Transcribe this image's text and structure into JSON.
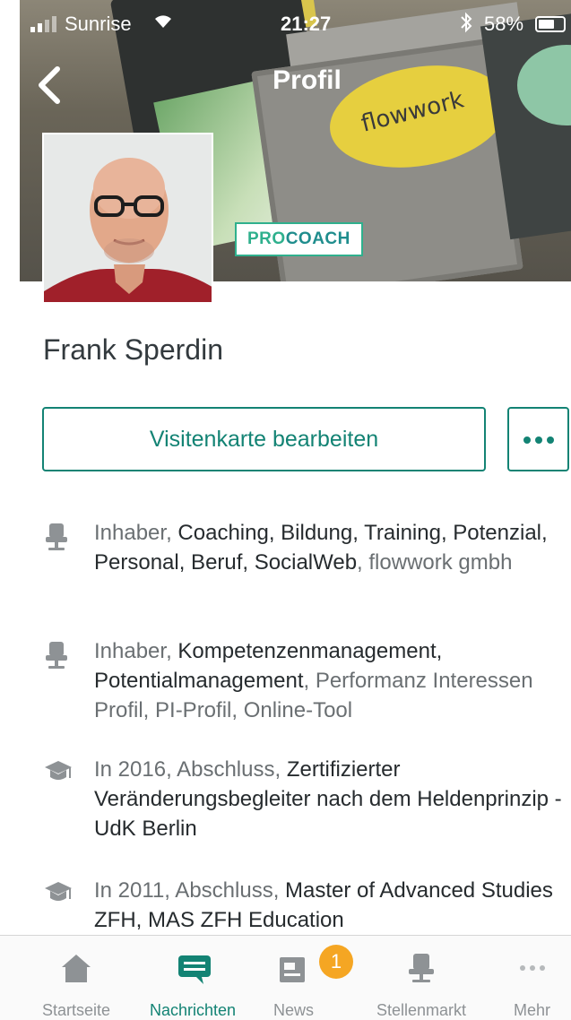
{
  "status_bar": {
    "carrier": "Sunrise",
    "time": "21:27",
    "battery": "58%"
  },
  "nav": {
    "title": "Profil"
  },
  "header_image": {
    "box_label": "flowwork"
  },
  "profile": {
    "badge_pro": "PRO",
    "badge_coach": "COACH",
    "name": "Frank Sperdin"
  },
  "actions": {
    "edit_label": "Visitenkarte bearbeiten"
  },
  "entries": [
    {
      "icon": "office-chair-icon",
      "lead": "Inhaber, ",
      "bold": "Coaching, Bildung, Training, Potenzial, Personal, Beruf, SocialWeb",
      "tail": ", flowwork gmbh"
    },
    {
      "icon": "office-chair-icon",
      "lead": "Inhaber, ",
      "bold": "Kompetenzenmanagement, Potentialmanagement",
      "tail": ", Performanz Interessen Profil, PI-Profil, Online-Tool"
    },
    {
      "icon": "graduation-cap-icon",
      "lead": "In 2016, Abschluss, ",
      "bold": "Zertifizierter Veränderungsbegleiter nach dem Heldenprinzip - UdK Berlin",
      "tail": ""
    },
    {
      "icon": "graduation-cap-icon",
      "lead": "In 2011, Abschluss, ",
      "bold": "Master of Advanced Studies ZFH, MAS ZFH Education",
      "tail": ""
    }
  ],
  "tabbar": {
    "tabs": [
      {
        "label": "Startseite",
        "icon": "home-icon"
      },
      {
        "label": "Nachrichten",
        "icon": "messages-icon"
      },
      {
        "label": "News",
        "icon": "news-icon"
      },
      {
        "label": "Stellenmarkt",
        "icon": "office-chair-icon"
      },
      {
        "label": "Mehr",
        "icon": "more-icon"
      }
    ],
    "active": "Nachrichten",
    "news_badge": "1"
  },
  "colors": {
    "accent": "#138374",
    "badge_green": "#2fb08d",
    "news_badge": "#f5a623"
  }
}
